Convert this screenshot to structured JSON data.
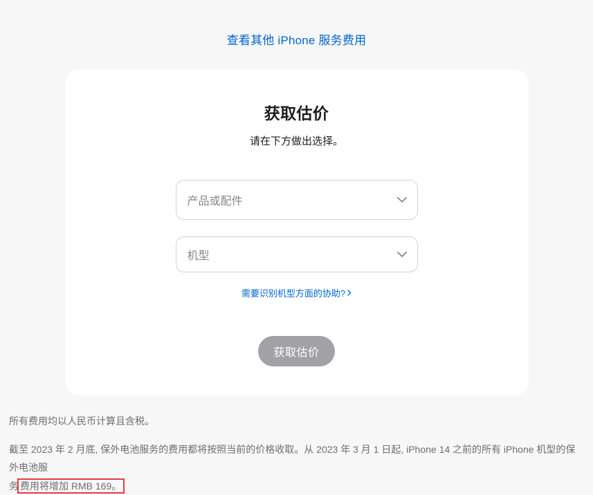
{
  "topLink": {
    "label": "查看其他 iPhone 服务费用"
  },
  "card": {
    "title": "获取估价",
    "subtitle": "请在下方做出选择。",
    "select1": {
      "placeholder": "产品或配件"
    },
    "select2": {
      "placeholder": "机型"
    },
    "helpLink": {
      "label": "需要识别机型方面的协助?"
    },
    "submit": {
      "label": "获取估价"
    }
  },
  "footnote": {
    "line1": "所有费用均以人民币计算且含税。",
    "line2a": "截至 2023 年 2 月底, 保外电池服务的费用都将按照当前的价格收取。从 2023 年 3 月 1 日起, iPhone 14 之前的所有 iPhone 机型的保外电池服",
    "line2b": "务",
    "line2c": "费用将增加 RMB 169。"
  }
}
